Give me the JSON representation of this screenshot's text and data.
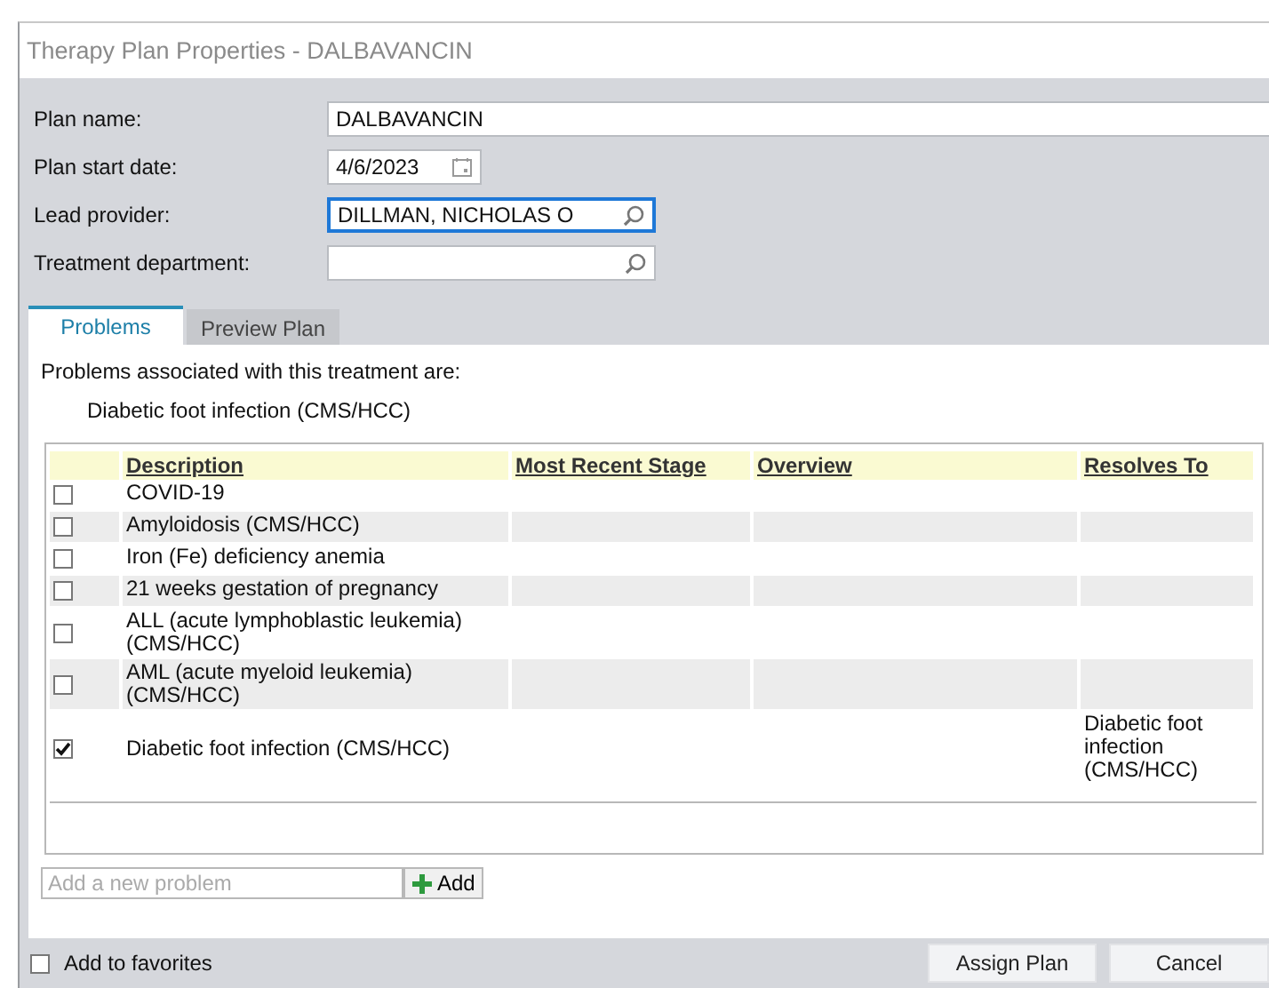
{
  "window": {
    "title": "Therapy Plan Properties - DALBAVANCIN"
  },
  "form": {
    "fields": [
      {
        "label": "Plan name:",
        "value": "DALBAVANCIN",
        "kind": "text",
        "focused": false
      },
      {
        "label": "Plan start date:",
        "value": "4/6/2023",
        "kind": "date",
        "focused": false
      },
      {
        "label": "Lead provider:",
        "value": "DILLMAN, NICHOLAS O",
        "kind": "lookup",
        "focused": true
      },
      {
        "label": "Treatment department:",
        "kind": "lookup",
        "focused": false
      }
    ]
  },
  "tabs": [
    {
      "label": "Problems",
      "selected": true
    },
    {
      "label": "Preview Plan",
      "selected": false
    }
  ],
  "problems": {
    "intro": "Problems associated with this treatment are:",
    "associated": [
      "Diabetic foot infection (CMS/HCC)"
    ],
    "columns": [
      "Description",
      "Most Recent Stage",
      "Overview",
      "Resolves To"
    ],
    "rows": [
      {
        "checked": false,
        "description": "COVID-19"
      },
      {
        "checked": false,
        "description": "Amyloidosis (CMS/HCC)"
      },
      {
        "checked": false,
        "description": "Iron (Fe) deficiency anemia"
      },
      {
        "checked": false,
        "description": "21 weeks gestation of pregnancy"
      },
      {
        "checked": false,
        "description": "ALL (acute lymphoblastic leukemia) (CMS/HCC)"
      },
      {
        "checked": false,
        "description": "AML (acute myeloid leukemia) (CMS/HCC)"
      },
      {
        "checked": true,
        "description": "Diabetic foot infection (CMS/HCC)",
        "resolves_to": "Diabetic foot infection (CMS/HCC)"
      }
    ],
    "add_field": {
      "placeholder": "Add a new problem"
    },
    "add_button": "Add"
  },
  "favorites": {
    "label": "Add to favorites",
    "checked": false
  },
  "buttons": [
    "Assign Plan",
    "Cancel"
  ]
}
